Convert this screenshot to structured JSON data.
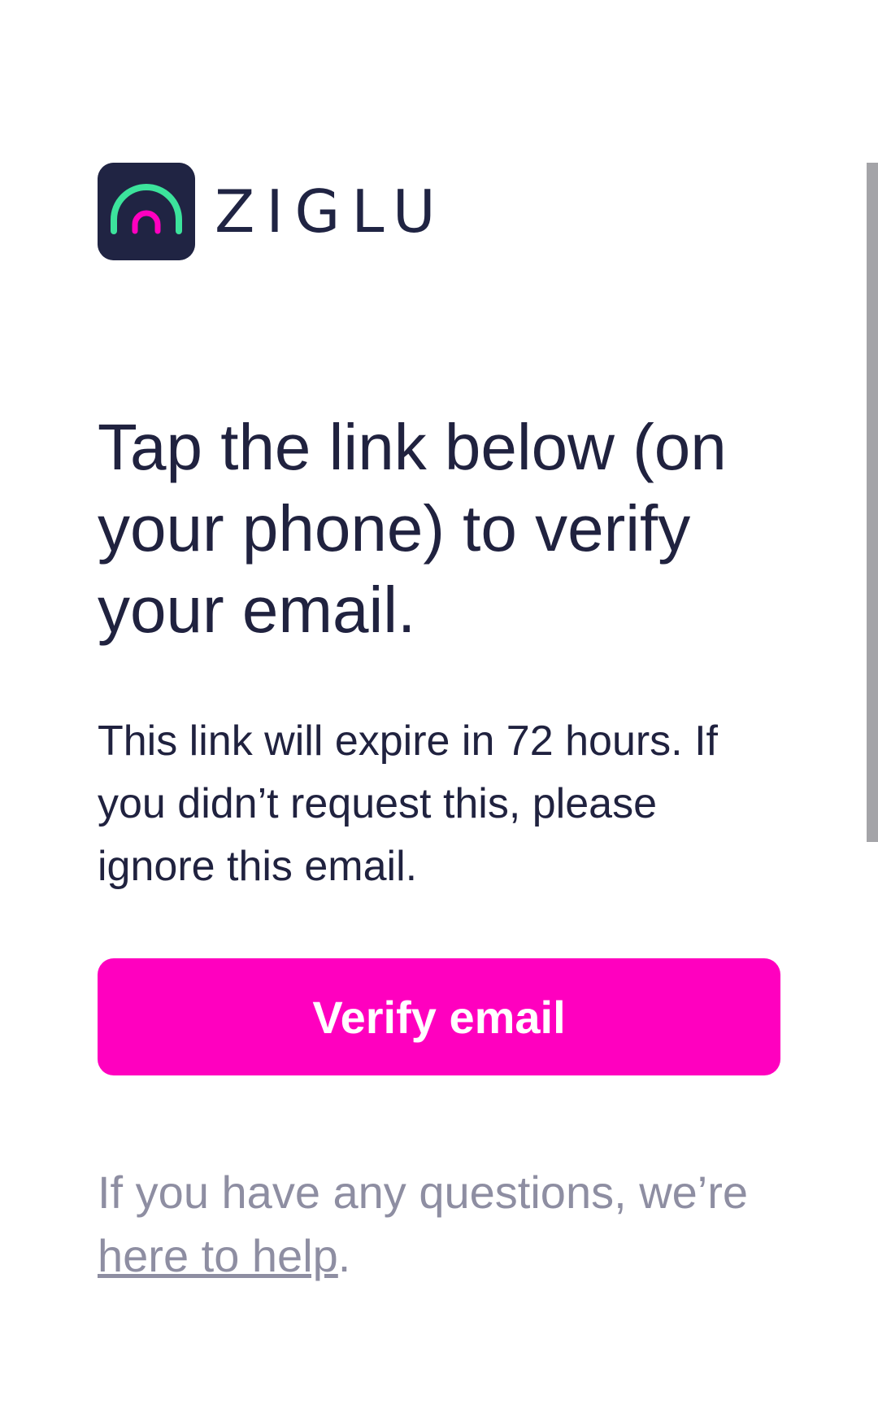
{
  "brand": {
    "name": "ZIGLU",
    "colors": {
      "mark_background": "#202443",
      "arc_outer": "#3ce39c",
      "arc_inner": "#ff00bf"
    }
  },
  "email": {
    "headline": "Tap the link below (on your phone) to verify your email.",
    "body": "This link will expire in 72 hours. If you didn’t request this, please ignore this email.",
    "button_label": "Verify email",
    "footer_prefix": "If you have any questions, we’re ",
    "footer_link": "here to help",
    "footer_suffix": "."
  },
  "colors": {
    "text": "#20223f",
    "button": "#ff00bf",
    "muted_text": "#8e8ea2",
    "scrollbar": "#a4a4a8"
  }
}
